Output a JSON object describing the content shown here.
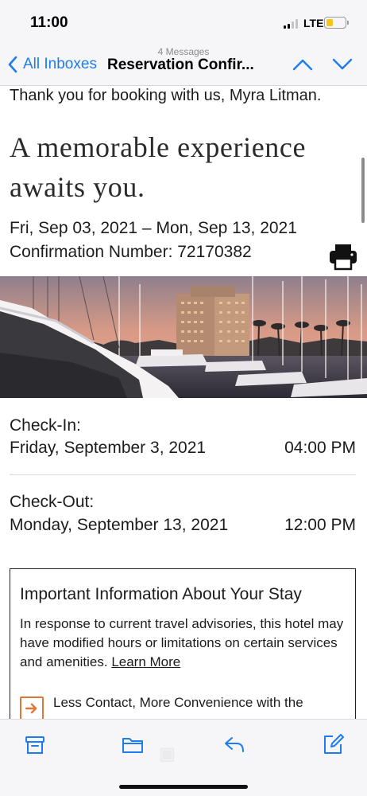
{
  "status_bar": {
    "time": "11:00",
    "network": "LTE",
    "battery_level": 0.35,
    "battery_color": "#f5c518"
  },
  "nav": {
    "message_count": "4 Messages",
    "back_label": "All Inboxes",
    "title": "Reservation Confir...",
    "up_icon": "chevron-up-icon",
    "down_icon": "chevron-down-icon",
    "accent_color": "#1f7cf0"
  },
  "email": {
    "thanks": "Thank you for booking with us, Myra Litman.",
    "headline": "A memorable experience awaits you.",
    "date_range": "Fri, Sep 03, 2021 – Mon, Sep 13, 2021",
    "confirmation": "Confirmation Number: 72170382",
    "print_icon": "printer-icon",
    "check_in": {
      "label": "Check-In:",
      "date": "Friday, September 3, 2021",
      "time": "04:00 PM"
    },
    "check_out": {
      "label": "Check-Out:",
      "date": "Monday, September 13, 2021",
      "time": "12:00 PM"
    },
    "info": {
      "title": "Important Information About Your Stay",
      "text": "In response to current travel advisories, this hotel may have modified hours or limitations on certain services and amenities.",
      "link": "Learn More",
      "feature_text": "Less Contact, More Convenience with the",
      "feature_icon": "arrow-right-box-icon",
      "feature_color": "#e0773a"
    }
  },
  "toolbar": {
    "archive_icon": "archive-icon",
    "folder_icon": "folder-icon",
    "reply_icon": "reply-icon",
    "compose_icon": "compose-icon"
  }
}
